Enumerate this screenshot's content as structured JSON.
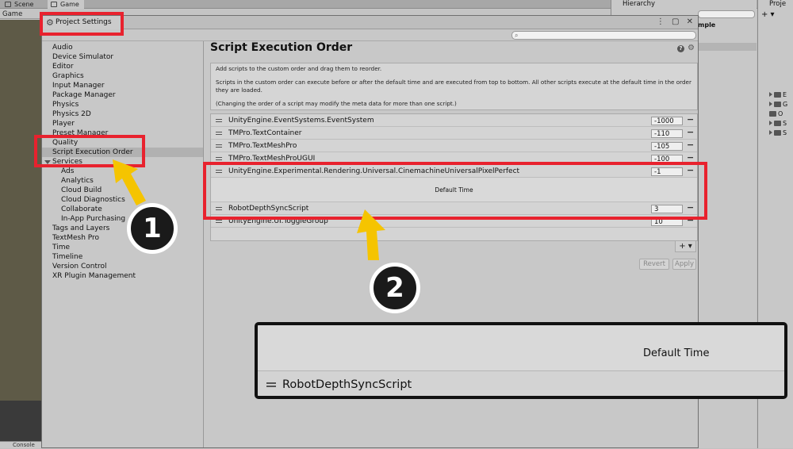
{
  "background": {
    "tabs": [
      "Scene",
      "Game"
    ],
    "game_label": "Game",
    "hierarchy_title": "Hierarchy",
    "hierarchy_item": "mple",
    "project_title": "Proje",
    "project_plus": "+ ▾",
    "project_rows": [
      "E",
      "G",
      "O",
      "S",
      "S"
    ],
    "console_label": "Console"
  },
  "window": {
    "title": "Project Settings",
    "controls": "⋮ ▢ ✕"
  },
  "sidebar": {
    "items": [
      {
        "label": "Audio"
      },
      {
        "label": "Device Simulator"
      },
      {
        "label": "Editor"
      },
      {
        "label": "Graphics"
      },
      {
        "label": "Input Manager"
      },
      {
        "label": "Package Manager"
      },
      {
        "label": "Physics"
      },
      {
        "label": "Physics 2D"
      },
      {
        "label": "Player"
      },
      {
        "label": "Preset Manager"
      },
      {
        "label": "Quality"
      },
      {
        "label": "Script Execution Order"
      },
      {
        "label": "Services"
      },
      {
        "label": "Ads"
      },
      {
        "label": "Analytics"
      },
      {
        "label": "Cloud Build"
      },
      {
        "label": "Cloud Diagnostics"
      },
      {
        "label": "Collaborate"
      },
      {
        "label": "In-App Purchasing"
      },
      {
        "label": "Tags and Layers"
      },
      {
        "label": "TextMesh Pro"
      },
      {
        "label": "Time"
      },
      {
        "label": "Timeline"
      },
      {
        "label": "Version Control"
      },
      {
        "label": "XR Plugin Management"
      }
    ]
  },
  "content": {
    "title": "Script Execution Order",
    "help_icon": "?",
    "info": [
      "Add scripts to the custom order and drag them to reorder.",
      "Scripts in the custom order can execute before or after the default time and are executed from top to bottom. All other scripts execute at the default time in the order they are loaded.",
      "(Changing the order of a script may modify the meta data for more than one script.)"
    ],
    "rows": [
      {
        "name": "UnityEngine.EventSystems.EventSystem",
        "value": "-1000"
      },
      {
        "name": "TMPro.TextContainer",
        "value": "-110"
      },
      {
        "name": "TMPro.TextMeshPro",
        "value": "-105"
      },
      {
        "name": "TMPro.TextMeshProUGUI",
        "value": "-100"
      },
      {
        "name": "UnityEngine.Experimental.Rendering.Universal.CinemachineUniversalPixelPerfect",
        "value": "-1"
      },
      {
        "name": "RobotDepthSyncScript",
        "value": "3"
      },
      {
        "name": "UnityEngine.UI.ToggleGroup",
        "value": "10"
      }
    ],
    "default_time": "Default Time",
    "add_label": "+ ▾",
    "revert_label": "Revert",
    "apply_label": "Apply"
  },
  "annotations": {
    "step1": "1",
    "step2": "2",
    "accent_red": "#e8222e",
    "arrow_yellow": "#f5c400"
  },
  "zoom": {
    "default_time": "Default Time",
    "script_name": "RobotDepthSyncScript"
  }
}
